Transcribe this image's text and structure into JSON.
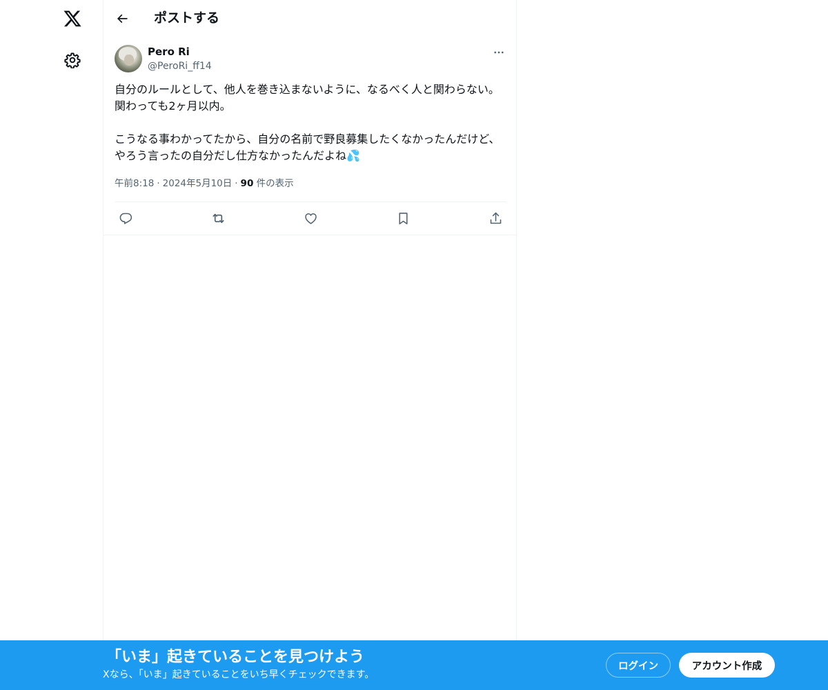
{
  "nav": {
    "logo_icon": "x-logo-icon",
    "settings_icon": "gear-icon"
  },
  "header": {
    "back_icon": "arrow-left-icon",
    "title": "ポストする"
  },
  "post": {
    "author": {
      "name": "Pero Ri",
      "handle": "@PeroRi_ff14"
    },
    "text": "自分のルールとして、他人を巻き込まないように、なるべく人と関わらない。関わっても2ヶ月以内。\n\nこうなる事わかってたから、自分の名前で野良募集したくなかったんだけど、やろう言ったの自分だし仕方なかったんだよね",
    "emoji": "💦",
    "time": "午前8:18",
    "date": "2024年5月10日",
    "separator": "·",
    "views_count": "90",
    "views_label": " 件の表示"
  },
  "actions": [
    {
      "name": "reply",
      "icon": "reply-icon"
    },
    {
      "name": "repost",
      "icon": "repost-icon"
    },
    {
      "name": "like",
      "icon": "heart-icon"
    },
    {
      "name": "bookmark",
      "icon": "bookmark-icon"
    },
    {
      "name": "share",
      "icon": "share-icon"
    }
  ],
  "banner": {
    "title": "「いま」起きていることを見つけよう",
    "subtitle": "Xなら、「いま」起きていることをいち早くチェックできます。",
    "login_label": "ログイン",
    "signup_label": "アカウント作成"
  },
  "colors": {
    "accent": "#1d9bf0",
    "text_primary": "#0f1419",
    "text_secondary": "#536471",
    "border": "#eff3f4"
  }
}
